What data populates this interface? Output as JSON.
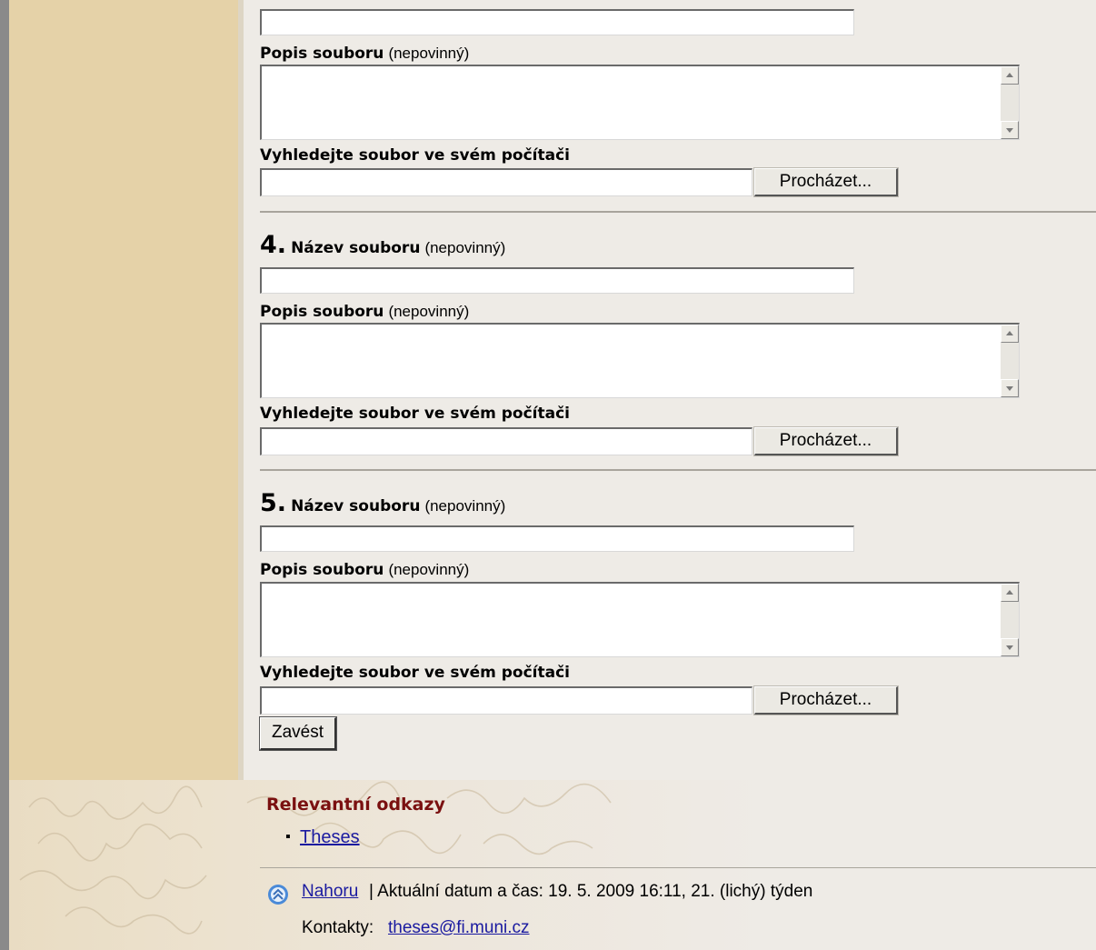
{
  "form": {
    "label_name": "Název souboru",
    "label_desc": "Popis souboru",
    "label_optional": "(nepovinný)",
    "label_browse_prompt": "Vyhledejte soubor ve svém počítači",
    "browse_label": "Procházet...",
    "sections": [
      {
        "number": "4."
      },
      {
        "number": "5."
      }
    ],
    "submit_label": "Zavést"
  },
  "footer": {
    "related_title": "Relevantní odkazy",
    "related_links": [
      "Theses"
    ],
    "top_link": "Nahoru",
    "datetime_text": "| Aktuální datum a čas: 19. 5. 2009 16:11, 21. (lichý) týden",
    "contacts_label": "Kontakty:",
    "contacts_email": "theses@fi.muni.cz"
  }
}
